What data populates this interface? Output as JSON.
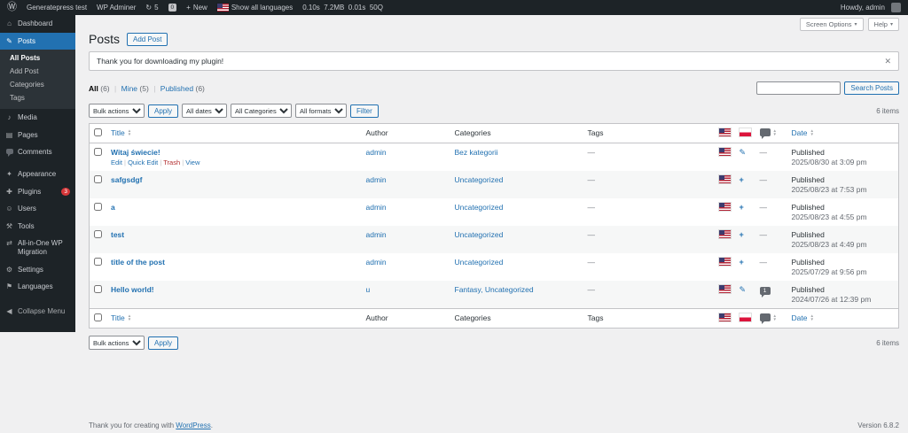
{
  "admin_bar": {
    "site_name": "Generatepress test",
    "wp_adminer": "WP Adminer",
    "updates_count": "5",
    "comments_count": "0",
    "new_label": "New",
    "languages_label": "Show all languages",
    "perf_stats": "0.10s  7.2MB  0.01s  50Q",
    "howdy": "Howdy, admin"
  },
  "icons": {
    "wp_logo": "Ⓦ",
    "refresh": "↻",
    "plus": "+",
    "chevron_down": "▾",
    "dismiss": "✕",
    "dashboard": "⌂",
    "posts": "✎",
    "media": "♪",
    "pages": "▤",
    "appearance": "✦",
    "plugins": "✚",
    "users": "☺",
    "tools": "⚒",
    "migration": "⇄",
    "settings": "⚙",
    "languages": "⚑",
    "collapse": "◀",
    "edit_translation": "✎",
    "add_translation": "+"
  },
  "sidebar": {
    "dashboard": "Dashboard",
    "posts": "Posts",
    "posts_submenu": {
      "all_posts": "All Posts",
      "add_post": "Add Post",
      "categories": "Categories",
      "tags": "Tags"
    },
    "media": "Media",
    "pages": "Pages",
    "comments": "Comments",
    "appearance": "Appearance",
    "plugins": "Plugins",
    "plugins_badge": "3",
    "users": "Users",
    "tools": "Tools",
    "migration": "All-in-One WP Migration",
    "settings": "Settings",
    "languages": "Languages",
    "collapse": "Collapse Menu"
  },
  "screen_meta": {
    "screen_options": "Screen Options",
    "help": "Help"
  },
  "page": {
    "title": "Posts",
    "add_post": "Add Post"
  },
  "notice": {
    "message": "Thank you for downloading my plugin!"
  },
  "views": {
    "all": "All",
    "all_count": "(6)",
    "mine": "Mine",
    "mine_count": "(5)",
    "published": "Published",
    "published_count": "(6)",
    "sep": "|"
  },
  "search": {
    "value": "",
    "button_label": "Search Posts"
  },
  "tablenav": {
    "bulk_actions": "Bulk actions",
    "apply": "Apply",
    "all_dates": "All dates",
    "all_categories": "All Categories",
    "all_formats": "All formats",
    "filter": "Filter",
    "item_count": "6 items"
  },
  "table": {
    "columns": {
      "title": "Title",
      "author": "Author",
      "categories": "Categories",
      "tags": "Tags",
      "date": "Date"
    },
    "rows": [
      {
        "title": "Witaj świecie!",
        "author": "admin",
        "categories": "Bez kategorii",
        "tags": "—",
        "comments": "—",
        "status": "Published",
        "date": "2025/08/30 at 3:09 pm"
      },
      {
        "title": "safgsdgf",
        "author": "admin",
        "categories": "Uncategorized",
        "tags": "—",
        "comments": "—",
        "status": "Published",
        "date": "2025/08/23 at 7:53 pm"
      },
      {
        "title": "a",
        "author": "admin",
        "categories": "Uncategorized",
        "tags": "—",
        "comments": "—",
        "status": "Published",
        "date": "2025/08/23 at 4:55 pm"
      },
      {
        "title": "test",
        "author": "admin",
        "categories": "Uncategorized",
        "tags": "—",
        "comments": "—",
        "status": "Published",
        "date": "2025/08/23 at 4:49 pm"
      },
      {
        "title": "title of the post",
        "author": "admin",
        "categories": "Uncategorized",
        "tags": "—",
        "comments": "—",
        "status": "Published",
        "date": "2025/07/29 at 9:56 pm"
      },
      {
        "title": "Hello world!",
        "author": "u",
        "categories": "Fantasy, Uncategorized",
        "tags": "—",
        "comments": "1",
        "status": "Published",
        "date": "2024/07/26 at 12:39 pm"
      }
    ]
  },
  "row_actions": {
    "edit": "Edit",
    "quick_edit": "Quick Edit",
    "trash": "Trash",
    "view": "View"
  },
  "footer": {
    "thanks": "Thank you for creating with",
    "wordpress": "WordPress",
    "period": ".",
    "version": "Version 6.8.2"
  }
}
